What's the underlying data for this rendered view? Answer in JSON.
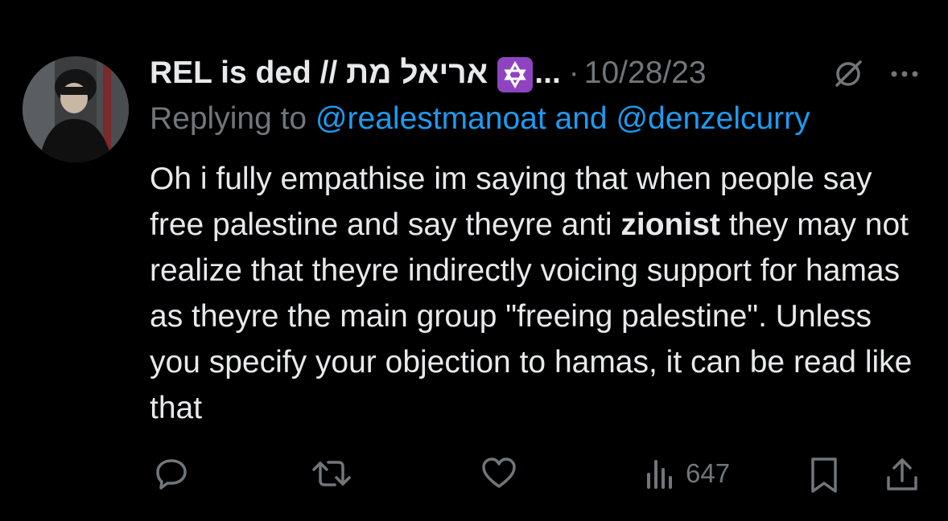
{
  "tweet": {
    "author_name": "REL is ded // אריאל מת",
    "badge_icon": "star-of-david-icon",
    "name_truncation": "...",
    "separator": "·",
    "date": "10/28/23",
    "reply_prefix": "Replying to",
    "mention_1": "@realestmanoat",
    "reply_conjunction": "and",
    "mention_2": "@denzelcurry",
    "text_before_bold": "Oh i fully empathise im saying that when people say free palestine and say theyre anti",
    "text_bold": "zionist",
    "text_after_bold": "they may not realize that theyre indirectly voicing support for hamas as theyre the main group \"freeing palestine\". Unless you specify your objection to hamas, it can be read like that",
    "views": "647"
  },
  "colors": {
    "background": "#000000",
    "primary_text": "#e7e9ea",
    "secondary_text": "#71767b",
    "link": "#1d9bf0",
    "badge": "#8e44c0"
  },
  "icons": {
    "grok": "grok-icon",
    "more": "more-icon",
    "reply": "reply-icon",
    "retweet": "retweet-icon",
    "like": "like-icon",
    "views": "views-icon",
    "bookmark": "bookmark-icon",
    "share": "share-icon"
  }
}
